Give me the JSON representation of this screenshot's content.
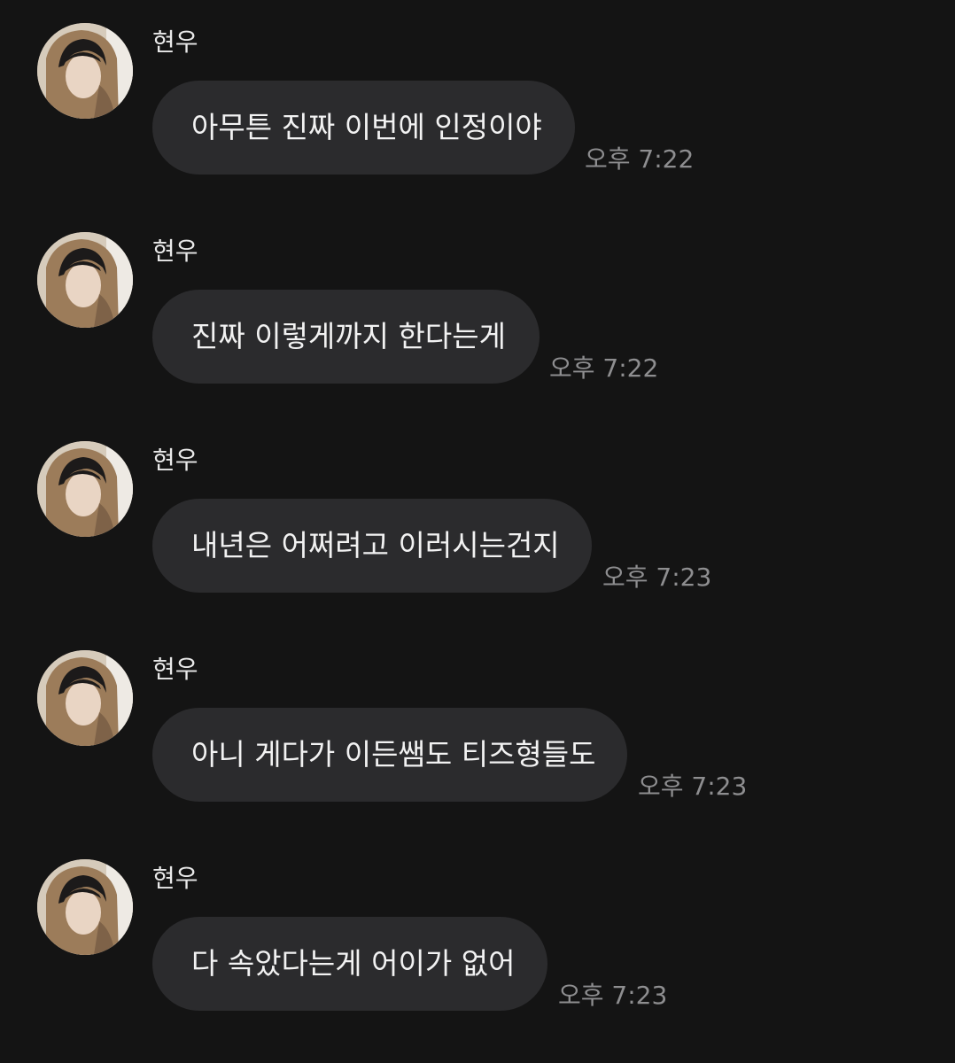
{
  "messages": [
    {
      "sender": "현우",
      "text": "아무튼 진짜 이번에 인정이야",
      "time": "오후 7:22"
    },
    {
      "sender": "현우",
      "text": "진짜 이렇게까지 한다는게",
      "time": "오후 7:22"
    },
    {
      "sender": "현우",
      "text": "내년은 어쩌려고 이러시는건지",
      "time": "오후 7:23"
    },
    {
      "sender": "현우",
      "text": "아니 게다가 이든쌤도 티즈형들도",
      "time": "오후 7:23"
    },
    {
      "sender": "현우",
      "text": "다 속았다는게 어이가 없어",
      "time": "오후 7:23"
    }
  ],
  "colors": {
    "background": "#141414",
    "bubble": "#2b2b2d",
    "text": "#f2f2f2",
    "time": "#8e8e90"
  },
  "icons": {
    "avatar": "profile-photo-avatar"
  }
}
